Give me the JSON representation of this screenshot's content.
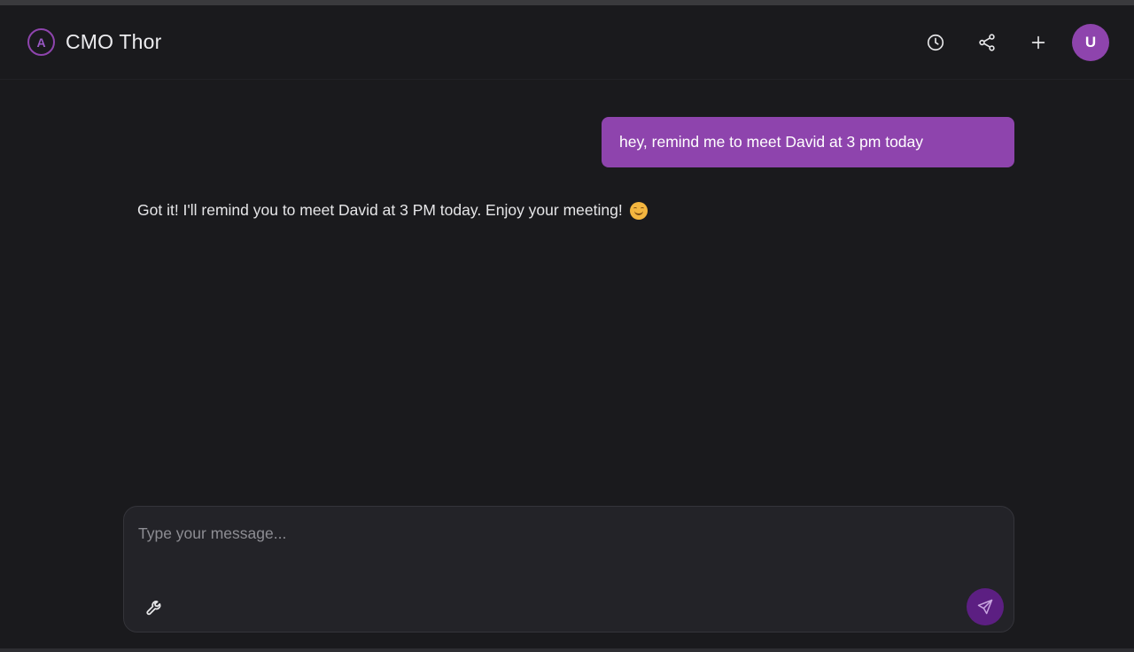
{
  "header": {
    "logo_letter": "A",
    "title": "CMO Thor",
    "actions": [
      {
        "name": "history",
        "icon": "clock-icon"
      },
      {
        "name": "share",
        "icon": "share-icon"
      },
      {
        "name": "new-chat",
        "icon": "plus-icon"
      }
    ],
    "avatar_initial": "U"
  },
  "conversation": {
    "messages": [
      {
        "role": "user",
        "text": "hey, remind me to meet David at 3 pm today"
      },
      {
        "role": "assistant",
        "text": "Got it! I'll remind you to meet David at 3 PM today. Enjoy your meeting!",
        "emoji": "smiling-face"
      }
    ]
  },
  "composer": {
    "placeholder": "Type your message...",
    "value": "",
    "tools_icon": "wrench-icon",
    "send_icon": "send-icon"
  },
  "colors": {
    "accent": "#8e44ad",
    "send_button": "#5c1f82",
    "background": "#1a1a1d",
    "composer_bg": "#232328"
  }
}
